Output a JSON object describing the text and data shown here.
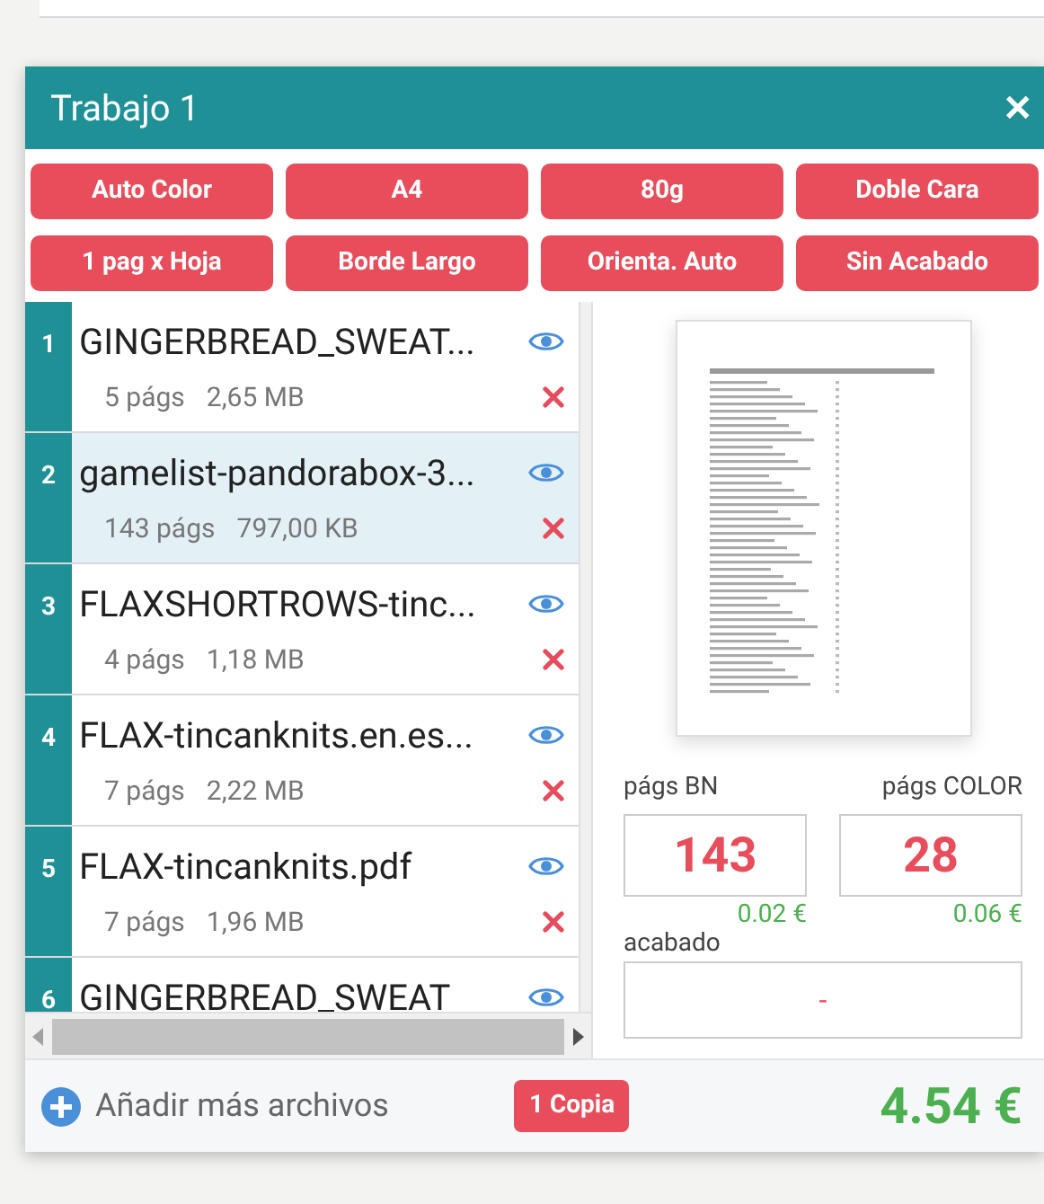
{
  "job": {
    "title": "Trabajo 1",
    "close": "✕"
  },
  "options": [
    "Auto Color",
    "A4",
    "80g",
    "Doble Cara",
    "1 pag x Hoja",
    "Borde Largo",
    "Orienta. Auto",
    "Sin Acabado"
  ],
  "files": [
    {
      "number": "1",
      "name": "GINGERBREAD_SWEAT...",
      "pages": "5 págs",
      "size": "2,65 MB",
      "selected": false
    },
    {
      "number": "2",
      "name": "gamelist-pandorabox-3...",
      "pages": "143 págs",
      "size": "797,00 KB",
      "selected": true
    },
    {
      "number": "3",
      "name": "FLAXSHORTROWS-tinc...",
      "pages": "4 págs",
      "size": "1,18 MB",
      "selected": false
    },
    {
      "number": "4",
      "name": "FLAX-tincanknits.en.es...",
      "pages": "7 págs",
      "size": "2,22 MB",
      "selected": false
    },
    {
      "number": "5",
      "name": "FLAX-tincanknits.pdf",
      "pages": "7 págs",
      "size": "1,96 MB",
      "selected": false
    },
    {
      "number": "6",
      "name": "GINGERBREAD_SWEAT",
      "selected": false
    }
  ],
  "counts": [
    {
      "label": "págs BN",
      "value": "143",
      "price": "0.02 €"
    },
    {
      "label": "págs COLOR",
      "value": "28",
      "price": "0.06 €"
    }
  ],
  "finish": {
    "label": "acabado",
    "value": "-"
  },
  "footer": {
    "add": "Añadir más archivos",
    "copies": "1 Copia",
    "total": "4.54 €"
  }
}
